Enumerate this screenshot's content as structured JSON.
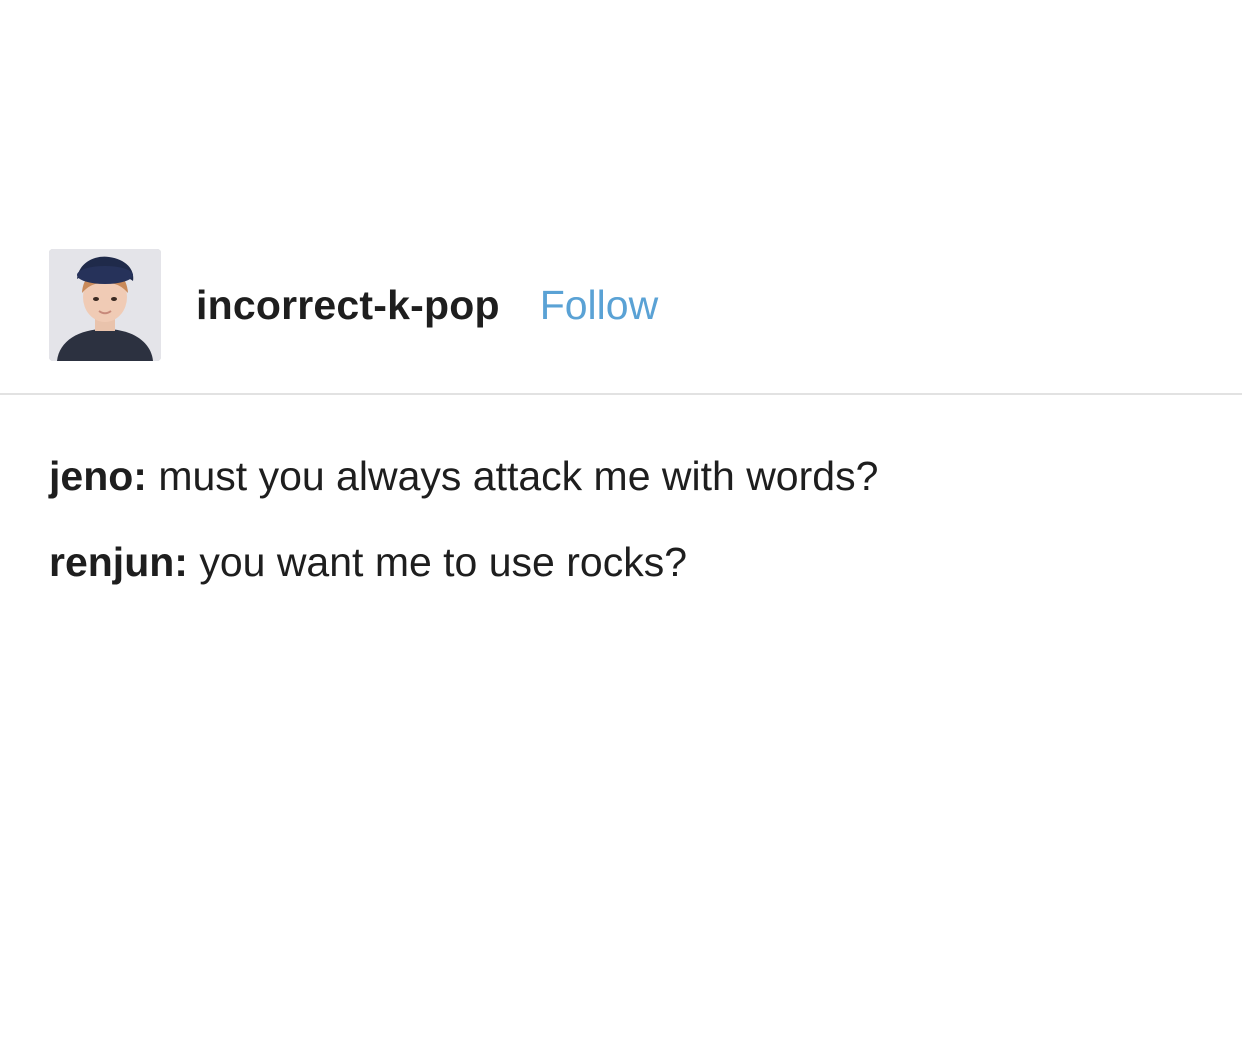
{
  "post": {
    "author": {
      "username": "incorrect-k-pop",
      "follow_label": "Follow",
      "avatar_icon": "profile-photo"
    },
    "lines": [
      {
        "speaker": "jeno:",
        "text": " must you always attack me with words?"
      },
      {
        "speaker": "renjun:",
        "text": " you want me to use rocks?"
      }
    ]
  },
  "colors": {
    "follow": "#5aa2d5",
    "text": "#1e1e1e",
    "divider": "#e2e2e2",
    "background": "#ffffff"
  }
}
